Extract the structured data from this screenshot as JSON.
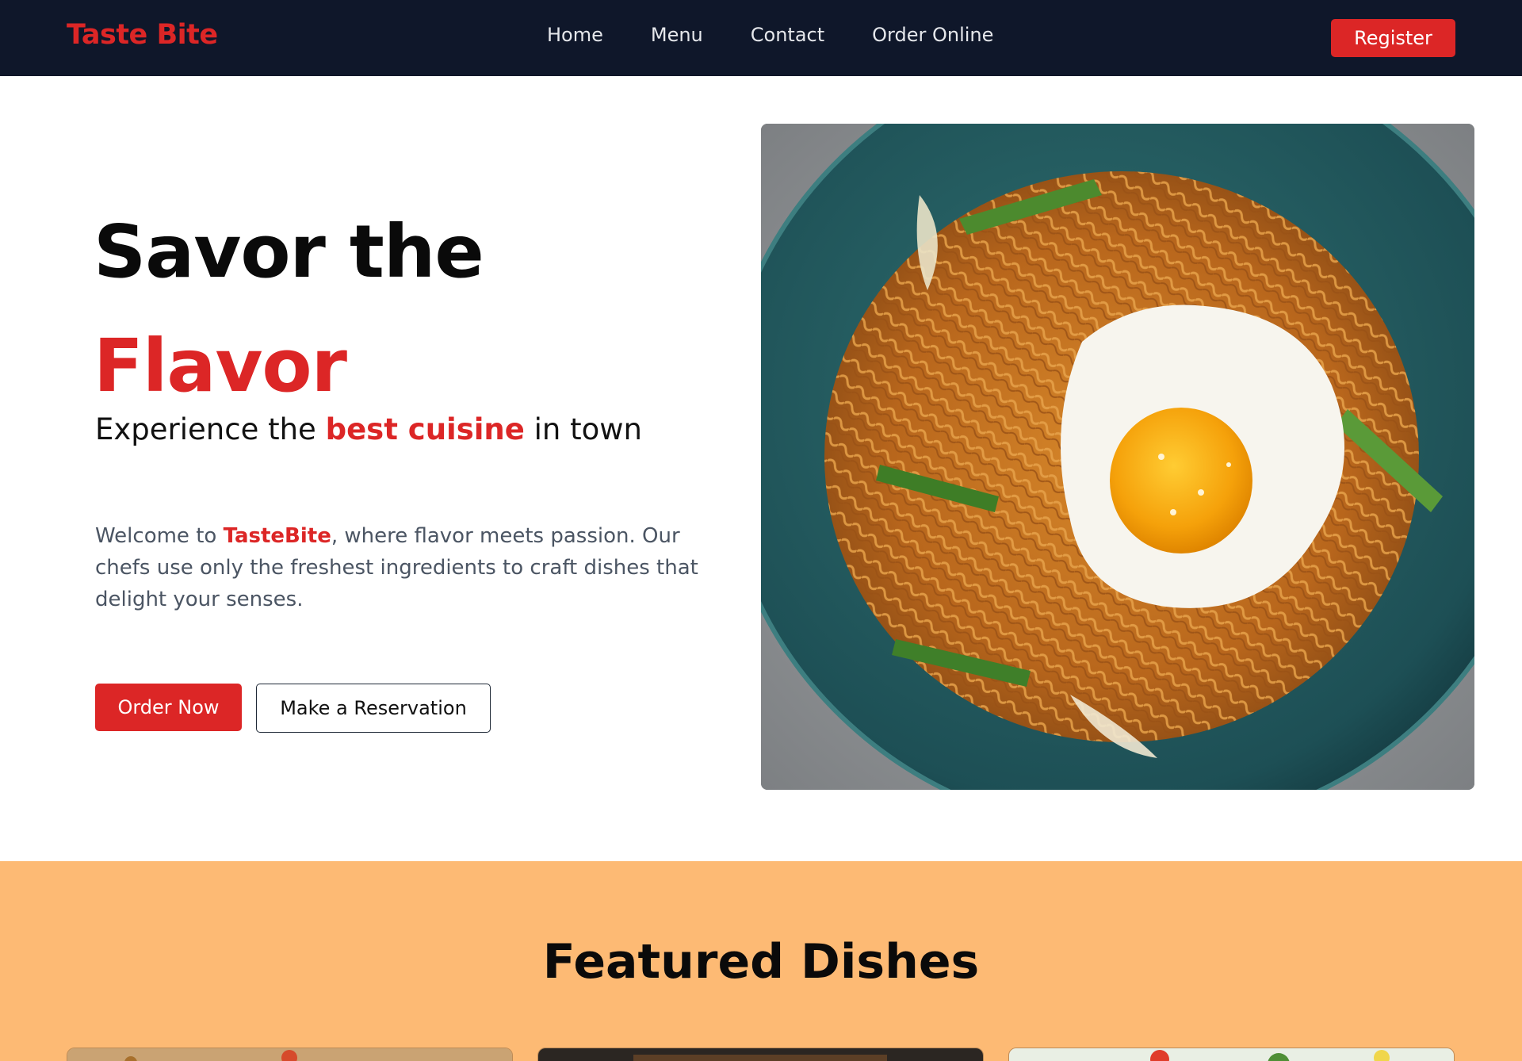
{
  "navbar": {
    "brand": "Taste Bite",
    "links": [
      {
        "label": "Home"
      },
      {
        "label": "Menu"
      },
      {
        "label": "Contact"
      },
      {
        "label": "Order Online"
      }
    ],
    "register_label": "Register"
  },
  "hero": {
    "title_line1": "Savor the",
    "title_line2": "Flavor",
    "subtitle_pre": "Experience the ",
    "subtitle_accent": "best cuisine",
    "subtitle_post": " in town",
    "desc_pre": "Welcome to ",
    "desc_brand": "TasteBite",
    "desc_post": ", where flavor meets passion. Our chefs use only the freshest ingredients to craft dishes that delight your senses.",
    "order_label": "Order Now",
    "reserve_label": "Make a Reservation"
  },
  "featured": {
    "title": "Featured Dishes"
  },
  "colors": {
    "navbar_bg": "#0f172a",
    "accent": "#dc2626",
    "featured_bg": "#fdba74"
  }
}
